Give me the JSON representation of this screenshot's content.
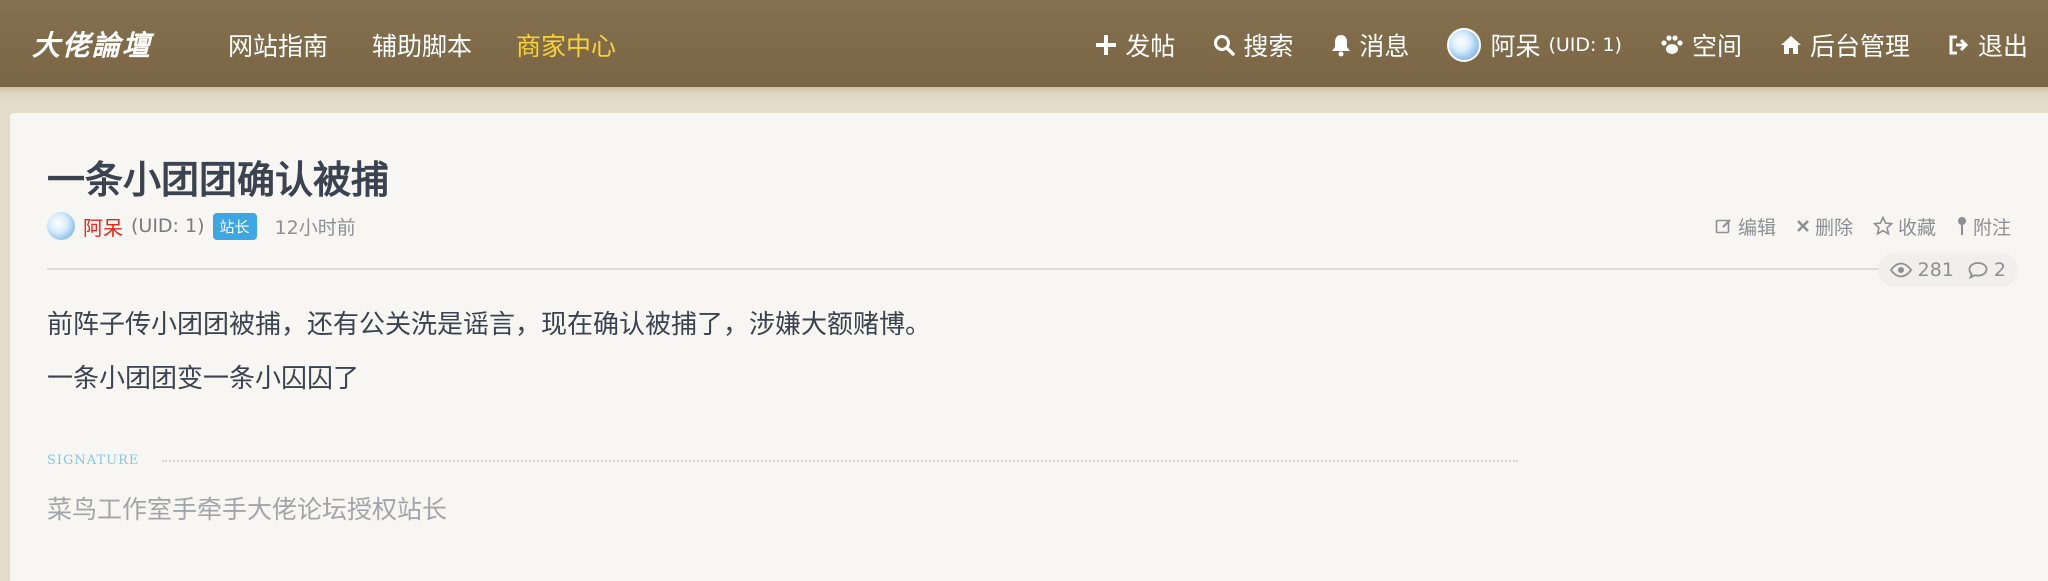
{
  "logo": {
    "text": "大佬論壇"
  },
  "nav": {
    "left": [
      {
        "label": "网站指南"
      },
      {
        "label": "辅助脚本"
      },
      {
        "label": "商家中心"
      }
    ],
    "right": {
      "post": "发帖",
      "search": "搜索",
      "messages": "消息",
      "user": "阿呆",
      "user_uid": "(UID: 1)",
      "space": "空间",
      "admin": "后台管理",
      "logout": "退出"
    },
    "active_color": "#f7d23a"
  },
  "post": {
    "title": "一条小团团确认被捕",
    "author": "阿呆",
    "author_uid": "(UID: 1)",
    "badge": "站长",
    "time": "12小时前",
    "actions": {
      "edit": "编辑",
      "delete": "删除",
      "favorite": "收藏",
      "note": "附注"
    },
    "views": "281",
    "replies": "2",
    "body": [
      "前阵子传小团团被捕，还有公关洗是谣言，现在确认被捕了，涉嫌大额赌博。",
      "一条小团团变一条小囚囚了"
    ],
    "signature_label": "SIGNATURE",
    "signature_text": "菜鸟工作室手牵手大佬论坛授权站长"
  },
  "icons": [
    "plus-icon",
    "search-icon",
    "bell-icon",
    "avatar",
    "paw-icon",
    "home-icon",
    "logout-icon",
    "edit-icon",
    "close-icon",
    "star-icon",
    "pin-icon",
    "eye-icon",
    "comment-icon"
  ]
}
